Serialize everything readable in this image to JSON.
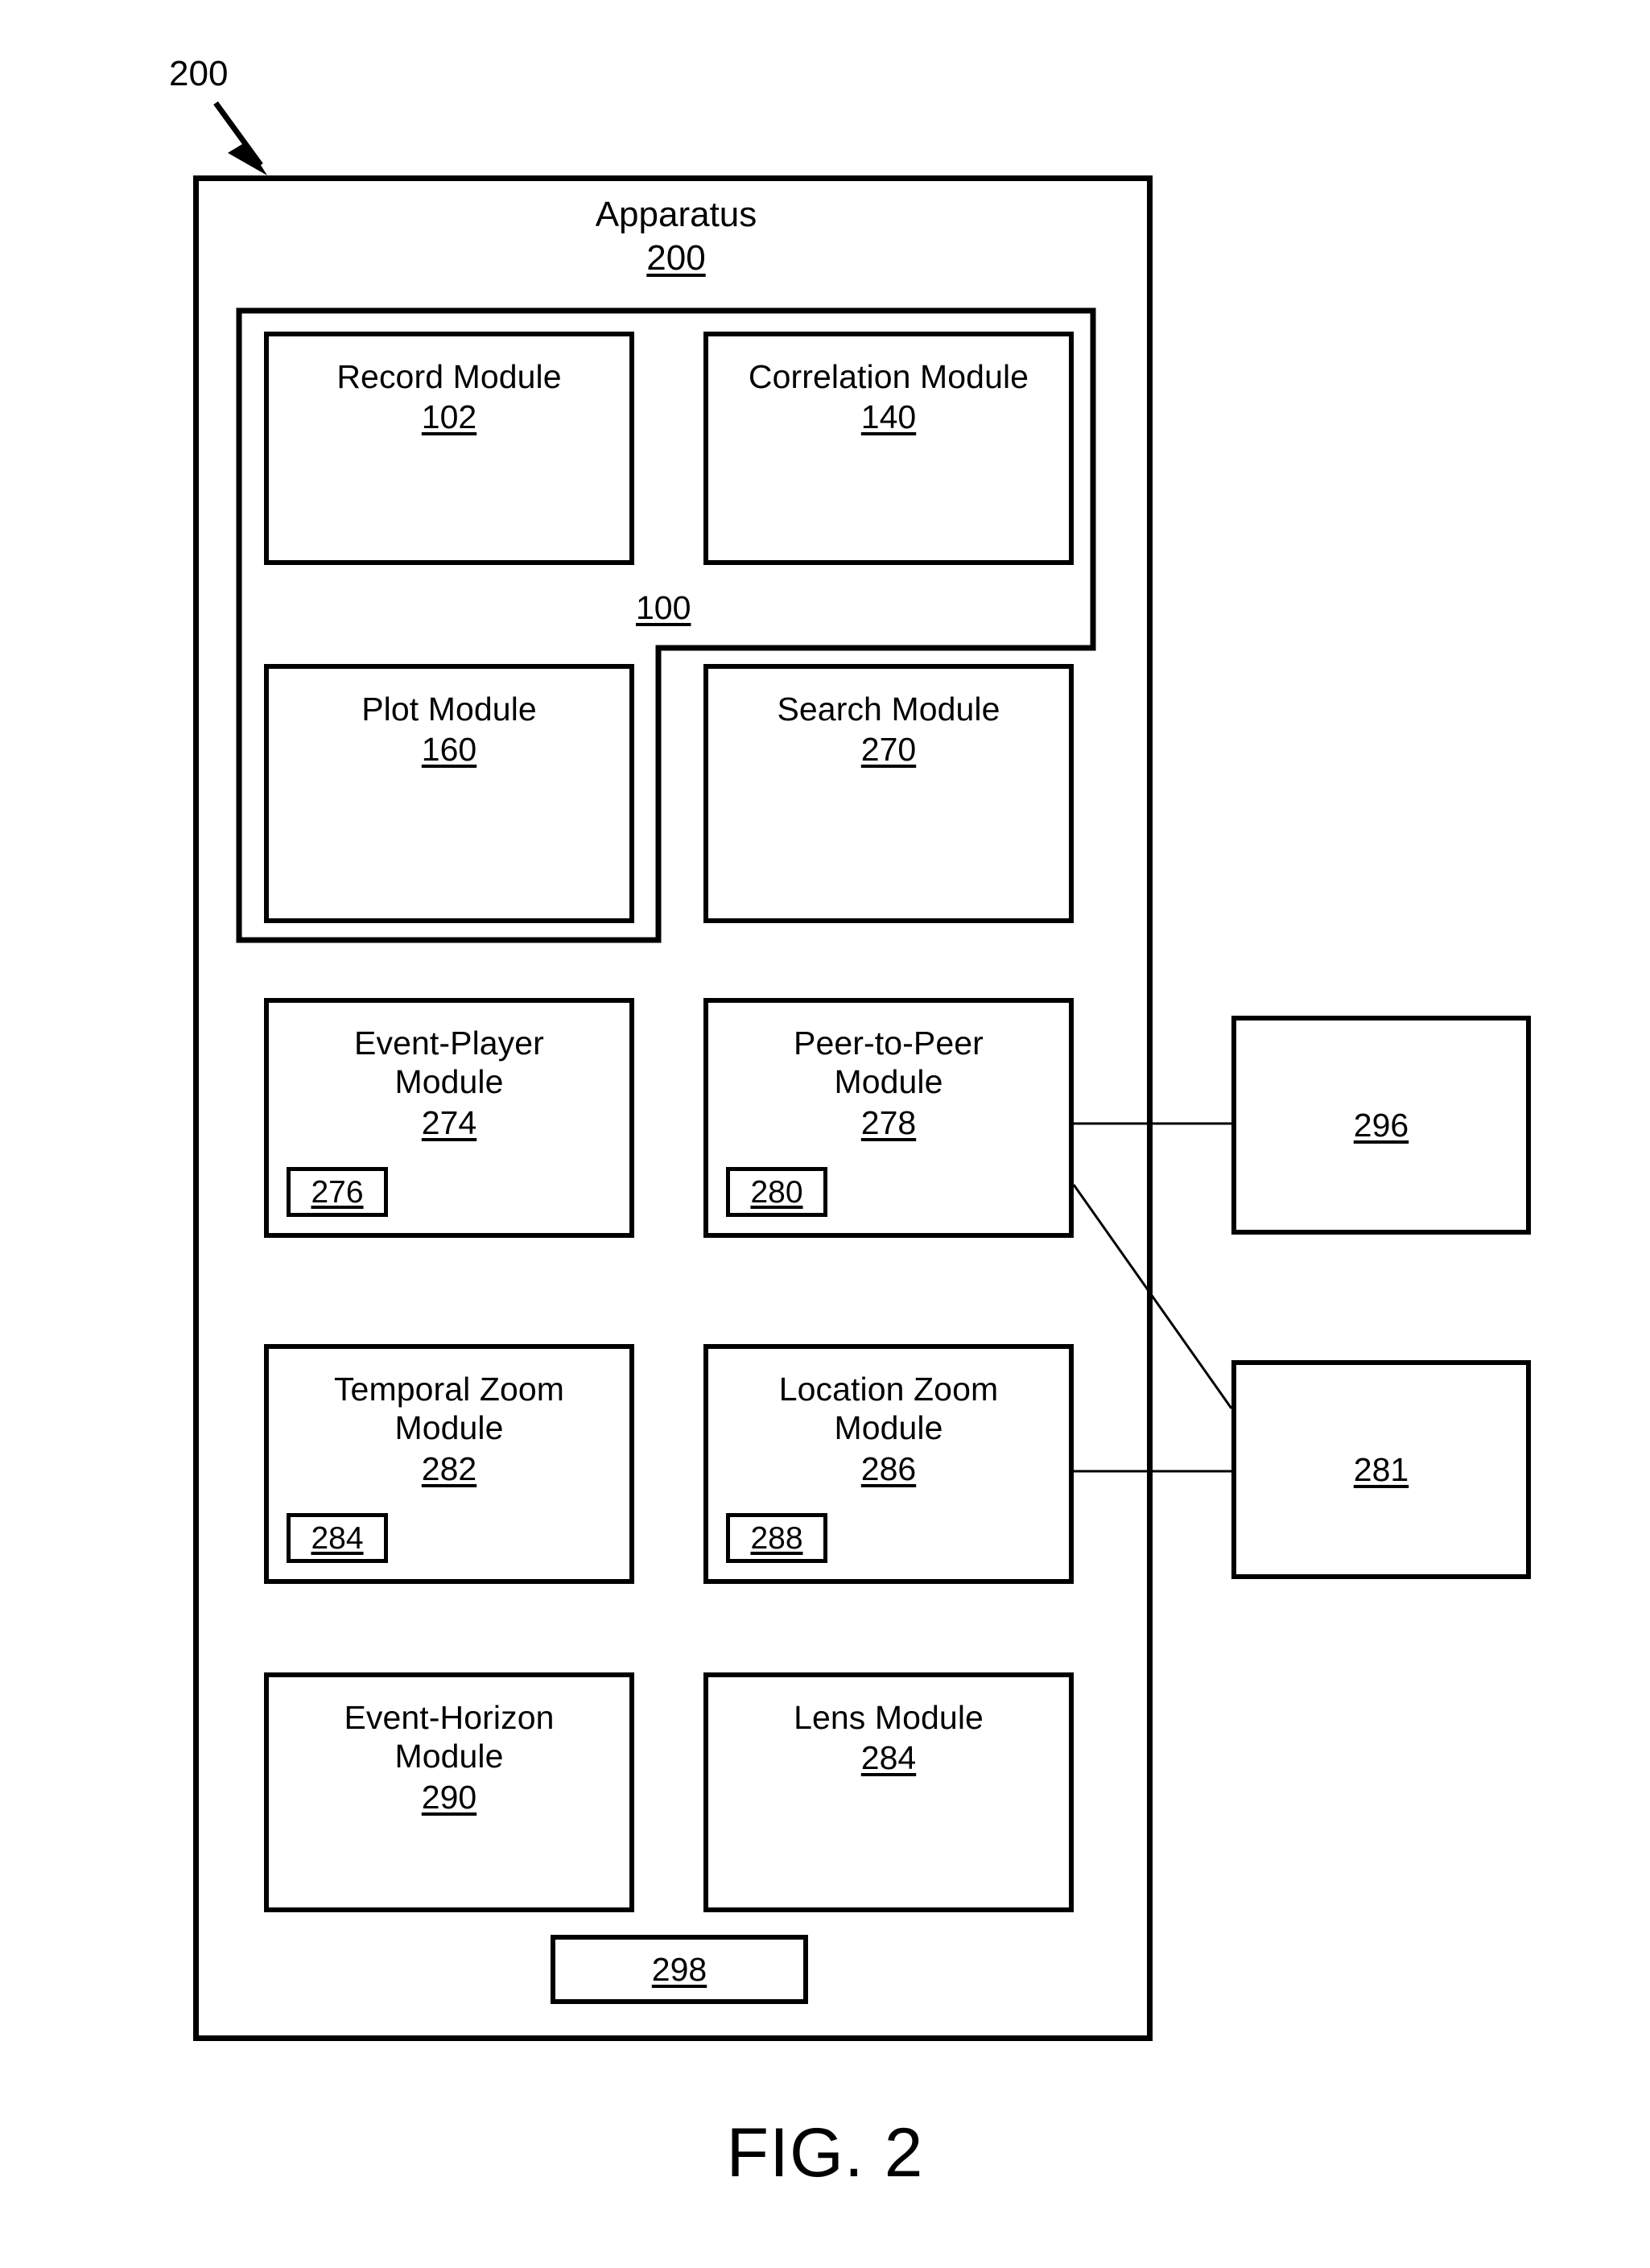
{
  "figure": {
    "caption": "FIG. 2",
    "lead_label": "200"
  },
  "apparatus": {
    "title": "Apparatus",
    "ref": "200"
  },
  "inner_container": {
    "ref": "100"
  },
  "modules": [
    {
      "title": "Record Module",
      "ref": "102"
    },
    {
      "title": "Correlation Module",
      "ref": "140"
    },
    {
      "title": "Plot Module",
      "ref": "160"
    },
    {
      "title": "Search Module",
      "ref": "270"
    },
    {
      "title": "Event-Player\nModule",
      "ref": "274",
      "sub_ref": "276"
    },
    {
      "title": "Peer-to-Peer\nModule",
      "ref": "278",
      "sub_ref": "280"
    },
    {
      "title": "Temporal Zoom\nModule",
      "ref": "282",
      "sub_ref": "284"
    },
    {
      "title": "Location Zoom\nModule",
      "ref": "286",
      "sub_ref": "288"
    },
    {
      "title": "Event-Horizon\nModule",
      "ref": "290"
    },
    {
      "title": "Lens Module",
      "ref": "284"
    }
  ],
  "external_boxes": [
    {
      "ref": "296"
    },
    {
      "ref": "281"
    }
  ],
  "bottom_box": {
    "ref": "298"
  },
  "colors": {
    "line": "#000000",
    "background": "#ffffff"
  }
}
